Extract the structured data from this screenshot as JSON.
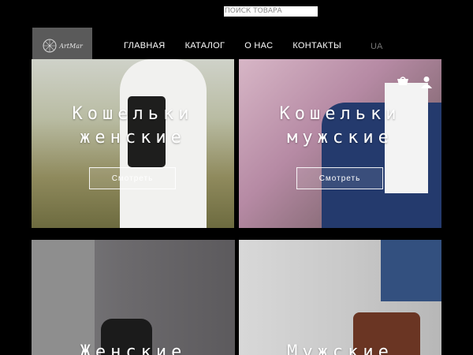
{
  "search": {
    "placeholder": "ПОИСК ТОВАРА"
  },
  "logo": {
    "text": "ArtMar"
  },
  "nav": {
    "items": [
      {
        "label": "ГЛАВНАЯ"
      },
      {
        "label": "КАТАЛОГ"
      },
      {
        "label": "О НАС"
      },
      {
        "label": "КОНТАКТЫ"
      }
    ]
  },
  "lang": {
    "current": "UA"
  },
  "header_icons": [
    "cart-icon",
    "user-icon"
  ],
  "tiles": [
    {
      "title_line1": "Кошельки",
      "title_line2": "женские",
      "button": "Смотреть"
    },
    {
      "title_line1": "Кошельки",
      "title_line2": "мужские",
      "button": "Смотреть"
    },
    {
      "title_line1": "Женские"
    },
    {
      "title_line1": "Мужские"
    }
  ]
}
